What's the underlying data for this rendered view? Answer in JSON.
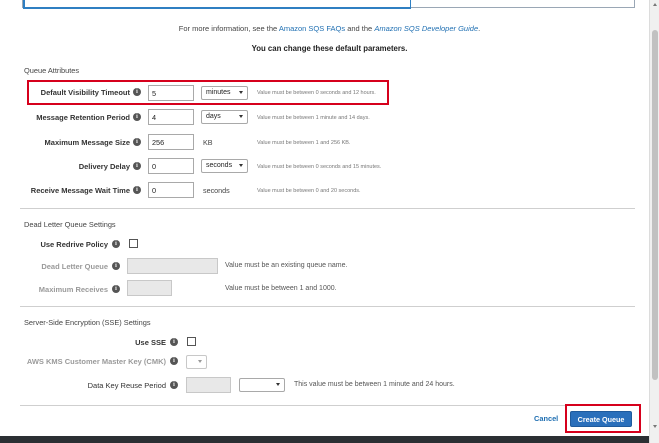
{
  "info": {
    "prefix": "For more information, see the ",
    "faq_link": "Amazon SQS FAQs",
    "and": " and the ",
    "guide_link": "Amazon SQS Developer Guide",
    "suffix": "."
  },
  "defaults_text": "You can change these default parameters.",
  "queue_attributes": {
    "title": "Queue Attributes",
    "rows": [
      {
        "label": "Default Visibility Timeout",
        "value": "5",
        "unit": "minutes",
        "hint": "Value must be between 0 seconds and 12 hours."
      },
      {
        "label": "Message Retention Period",
        "value": "4",
        "unit": "days",
        "hint": "Value must be between 1 minute and 14 days."
      },
      {
        "label": "Maximum Message Size",
        "value": "256",
        "unit": "KB",
        "hint": "Value must be between 1 and 256 KB."
      },
      {
        "label": "Delivery Delay",
        "value": "0",
        "unit": "seconds",
        "hint": "Value must be between 0 seconds and 15 minutes."
      },
      {
        "label": "Receive Message Wait Time",
        "value": "0",
        "unit": "seconds",
        "hint": "Value must be between 0 and 20 seconds."
      }
    ]
  },
  "dlq": {
    "title": "Dead Letter Queue Settings",
    "use_redrive_label": "Use Redrive Policy",
    "dead_letter_queue_label": "Dead Letter Queue",
    "dead_letter_queue_hint": "Value must be an existing queue name.",
    "max_receives_label": "Maximum Receives",
    "max_receives_hint": "Value must be between 1 and 1000."
  },
  "sse": {
    "title": "Server-Side Encryption (SSE) Settings",
    "use_sse_label": "Use SSE",
    "cmk_label": "AWS KMS Customer Master Key (CMK)",
    "reuse_label": "Data Key Reuse Period",
    "reuse_hint": "This value must be between 1 minute and 24 hours."
  },
  "actions": {
    "cancel": "Cancel",
    "create": "Create Queue"
  },
  "colors": {
    "link": "#1f6fb2",
    "primary": "#2a6fbb",
    "highlight": "#d6001c"
  }
}
